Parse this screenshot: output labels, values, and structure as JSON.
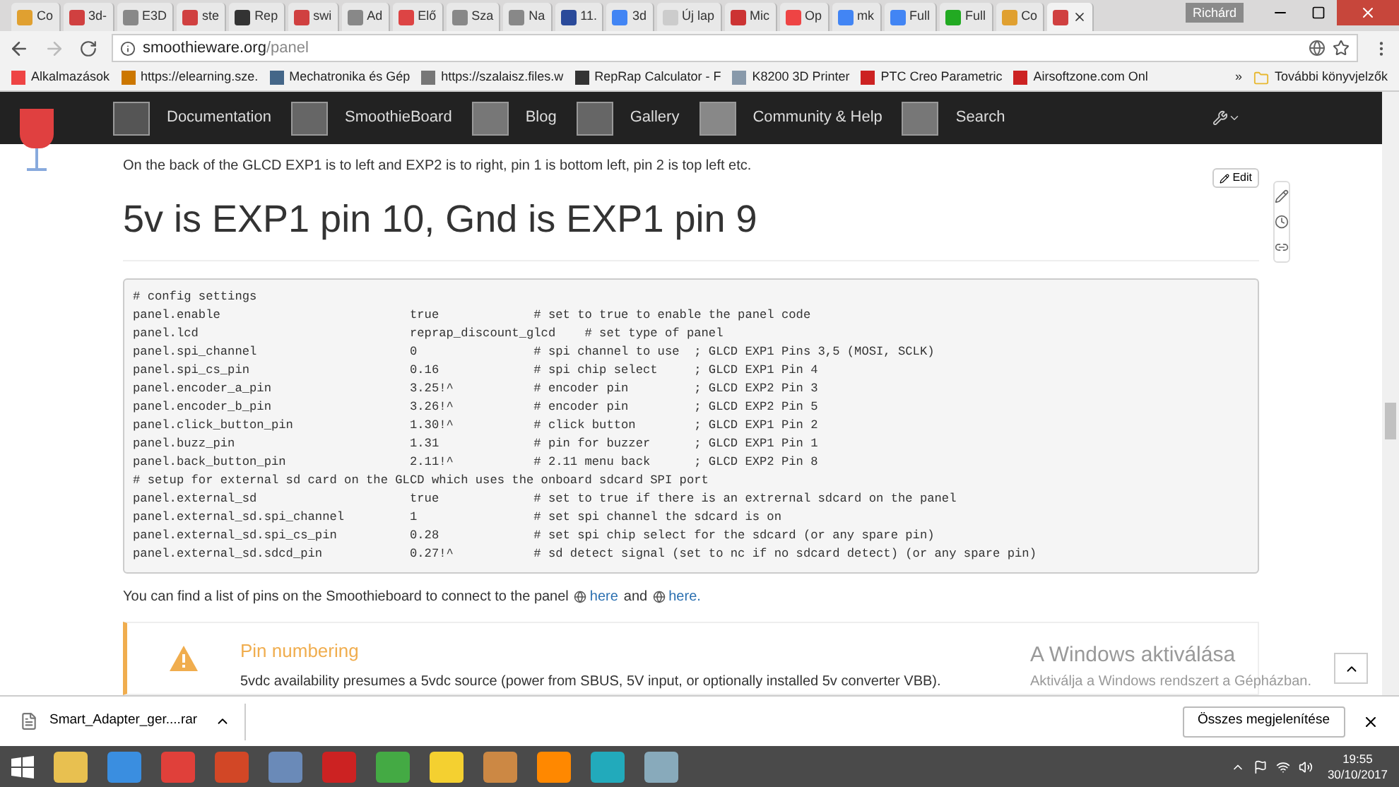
{
  "browser": {
    "tabs": [
      {
        "title": "Co",
        "selected": false
      },
      {
        "title": "3d-",
        "selected": false
      },
      {
        "title": "E3D",
        "selected": false
      },
      {
        "title": "ste",
        "selected": false
      },
      {
        "title": "Rep",
        "selected": false
      },
      {
        "title": "swi",
        "selected": false
      },
      {
        "title": "Ad",
        "selected": false
      },
      {
        "title": "Elő",
        "selected": false
      },
      {
        "title": "Sza",
        "selected": false
      },
      {
        "title": "Na",
        "selected": false
      },
      {
        "title": "11.",
        "selected": false
      },
      {
        "title": "3d",
        "selected": false
      },
      {
        "title": "Új lap",
        "selected": false
      },
      {
        "title": "Mic",
        "selected": false
      },
      {
        "title": "Op",
        "selected": false
      },
      {
        "title": "mk",
        "selected": false
      },
      {
        "title": "Full",
        "selected": false
      },
      {
        "title": "Full",
        "selected": false
      },
      {
        "title": "Co",
        "selected": false
      },
      {
        "selected": true
      }
    ],
    "user": "Richárd",
    "url_host": "smoothieware.org",
    "url_path": "/panel",
    "bookmarks": [
      "Alkalmazások",
      "https://elearning.sze.",
      "Mechatronika és Gép",
      "https://szalaisz.files.w",
      "RepRap Calculator - F",
      "K8200 3D Printer",
      "PTC Creo Parametric",
      "Airsoftzone.com Onl"
    ],
    "bookmarks_more": "»",
    "bookmarks_other": "További könyvjelzők"
  },
  "nav": {
    "items": [
      "Documentation",
      "SmoothieBoard",
      "Blog",
      "Gallery",
      "Community & Help",
      "Search"
    ]
  },
  "page": {
    "intro": "On the back of the GLCD EXP1 is to left and EXP2 is to right, pin 1 is bottom left, pin 2 is top left etc.",
    "edit": "Edit",
    "heading": "5v is EXP1 pin 10, Gnd is EXP1 pin 9",
    "code": [
      "# config settings",
      "panel.enable                          true             # set to true to enable the panel code",
      "panel.lcd                             reprap_discount_glcd    # set type of panel",
      "panel.spi_channel                     0                # spi channel to use  ; GLCD EXP1 Pins 3,5 (MOSI, SCLK)",
      "panel.spi_cs_pin                      0.16             # spi chip select     ; GLCD EXP1 Pin 4",
      "panel.encoder_a_pin                   3.25!^           # encoder pin         ; GLCD EXP2 Pin 3",
      "panel.encoder_b_pin                   3.26!^           # encoder pin         ; GLCD EXP2 Pin 5",
      "panel.click_button_pin                1.30!^           # click button        ; GLCD EXP1 Pin 2",
      "panel.buzz_pin                        1.31             # pin for buzzer      ; GLCD EXP1 Pin 1",
      "panel.back_button_pin                 2.11!^           # 2.11 menu back      ; GLCD EXP2 Pin 8",
      "# setup for external sd card on the GLCD which uses the onboard sdcard SPI port",
      "panel.external_sd                     true             # set to true if there is an extrernal sdcard on the panel",
      "panel.external_sd.spi_channel         1                # set spi channel the sdcard is on",
      "panel.external_sd.spi_cs_pin          0.28             # set spi chip select for the sdcard (or any spare pin)",
      "panel.external_sd.sdcd_pin            0.27!^           # sd detect signal (set to nc if no sdcard detect) (or any spare pin)"
    ],
    "pins_text": "You can find a list of pins on the Smoothieboard to connect to the panel",
    "link1": "here",
    "and": "and",
    "link2": "here.",
    "callout_title": "Pin numbering",
    "callout_text": "5vdc availability presumes a 5vdc source (power from SBUS, 5V input, or optionally installed 5v converter VBB).",
    "watermark_title": "A Windows aktiválása",
    "watermark_text": "Aktiválja a Windows rendszert a Gépházban."
  },
  "downloads": {
    "file": "Smart_Adapter_ger....rar",
    "show_all": "Összes megjelenítése"
  },
  "taskbar": {
    "time": "19:55",
    "date": "30/10/2017"
  }
}
